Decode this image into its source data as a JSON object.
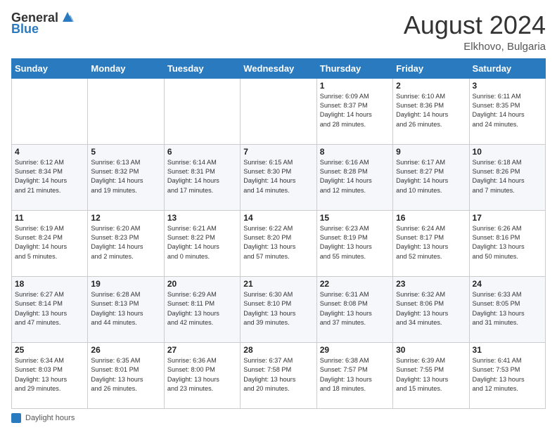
{
  "header": {
    "logo_general": "General",
    "logo_blue": "Blue",
    "month_title": "August 2024",
    "location": "Elkhovo, Bulgaria"
  },
  "days_of_week": [
    "Sunday",
    "Monday",
    "Tuesday",
    "Wednesday",
    "Thursday",
    "Friday",
    "Saturday"
  ],
  "footer": {
    "label": "Daylight hours"
  },
  "weeks": [
    [
      {
        "day": "",
        "detail": ""
      },
      {
        "day": "",
        "detail": ""
      },
      {
        "day": "",
        "detail": ""
      },
      {
        "day": "",
        "detail": ""
      },
      {
        "day": "1",
        "detail": "Sunrise: 6:09 AM\nSunset: 8:37 PM\nDaylight: 14 hours\nand 28 minutes."
      },
      {
        "day": "2",
        "detail": "Sunrise: 6:10 AM\nSunset: 8:36 PM\nDaylight: 14 hours\nand 26 minutes."
      },
      {
        "day": "3",
        "detail": "Sunrise: 6:11 AM\nSunset: 8:35 PM\nDaylight: 14 hours\nand 24 minutes."
      }
    ],
    [
      {
        "day": "4",
        "detail": "Sunrise: 6:12 AM\nSunset: 8:34 PM\nDaylight: 14 hours\nand 21 minutes."
      },
      {
        "day": "5",
        "detail": "Sunrise: 6:13 AM\nSunset: 8:32 PM\nDaylight: 14 hours\nand 19 minutes."
      },
      {
        "day": "6",
        "detail": "Sunrise: 6:14 AM\nSunset: 8:31 PM\nDaylight: 14 hours\nand 17 minutes."
      },
      {
        "day": "7",
        "detail": "Sunrise: 6:15 AM\nSunset: 8:30 PM\nDaylight: 14 hours\nand 14 minutes."
      },
      {
        "day": "8",
        "detail": "Sunrise: 6:16 AM\nSunset: 8:28 PM\nDaylight: 14 hours\nand 12 minutes."
      },
      {
        "day": "9",
        "detail": "Sunrise: 6:17 AM\nSunset: 8:27 PM\nDaylight: 14 hours\nand 10 minutes."
      },
      {
        "day": "10",
        "detail": "Sunrise: 6:18 AM\nSunset: 8:26 PM\nDaylight: 14 hours\nand 7 minutes."
      }
    ],
    [
      {
        "day": "11",
        "detail": "Sunrise: 6:19 AM\nSunset: 8:24 PM\nDaylight: 14 hours\nand 5 minutes."
      },
      {
        "day": "12",
        "detail": "Sunrise: 6:20 AM\nSunset: 8:23 PM\nDaylight: 14 hours\nand 2 minutes."
      },
      {
        "day": "13",
        "detail": "Sunrise: 6:21 AM\nSunset: 8:22 PM\nDaylight: 14 hours\nand 0 minutes."
      },
      {
        "day": "14",
        "detail": "Sunrise: 6:22 AM\nSunset: 8:20 PM\nDaylight: 13 hours\nand 57 minutes."
      },
      {
        "day": "15",
        "detail": "Sunrise: 6:23 AM\nSunset: 8:19 PM\nDaylight: 13 hours\nand 55 minutes."
      },
      {
        "day": "16",
        "detail": "Sunrise: 6:24 AM\nSunset: 8:17 PM\nDaylight: 13 hours\nand 52 minutes."
      },
      {
        "day": "17",
        "detail": "Sunrise: 6:26 AM\nSunset: 8:16 PM\nDaylight: 13 hours\nand 50 minutes."
      }
    ],
    [
      {
        "day": "18",
        "detail": "Sunrise: 6:27 AM\nSunset: 8:14 PM\nDaylight: 13 hours\nand 47 minutes."
      },
      {
        "day": "19",
        "detail": "Sunrise: 6:28 AM\nSunset: 8:13 PM\nDaylight: 13 hours\nand 44 minutes."
      },
      {
        "day": "20",
        "detail": "Sunrise: 6:29 AM\nSunset: 8:11 PM\nDaylight: 13 hours\nand 42 minutes."
      },
      {
        "day": "21",
        "detail": "Sunrise: 6:30 AM\nSunset: 8:10 PM\nDaylight: 13 hours\nand 39 minutes."
      },
      {
        "day": "22",
        "detail": "Sunrise: 6:31 AM\nSunset: 8:08 PM\nDaylight: 13 hours\nand 37 minutes."
      },
      {
        "day": "23",
        "detail": "Sunrise: 6:32 AM\nSunset: 8:06 PM\nDaylight: 13 hours\nand 34 minutes."
      },
      {
        "day": "24",
        "detail": "Sunrise: 6:33 AM\nSunset: 8:05 PM\nDaylight: 13 hours\nand 31 minutes."
      }
    ],
    [
      {
        "day": "25",
        "detail": "Sunrise: 6:34 AM\nSunset: 8:03 PM\nDaylight: 13 hours\nand 29 minutes."
      },
      {
        "day": "26",
        "detail": "Sunrise: 6:35 AM\nSunset: 8:01 PM\nDaylight: 13 hours\nand 26 minutes."
      },
      {
        "day": "27",
        "detail": "Sunrise: 6:36 AM\nSunset: 8:00 PM\nDaylight: 13 hours\nand 23 minutes."
      },
      {
        "day": "28",
        "detail": "Sunrise: 6:37 AM\nSunset: 7:58 PM\nDaylight: 13 hours\nand 20 minutes."
      },
      {
        "day": "29",
        "detail": "Sunrise: 6:38 AM\nSunset: 7:57 PM\nDaylight: 13 hours\nand 18 minutes."
      },
      {
        "day": "30",
        "detail": "Sunrise: 6:39 AM\nSunset: 7:55 PM\nDaylight: 13 hours\nand 15 minutes."
      },
      {
        "day": "31",
        "detail": "Sunrise: 6:41 AM\nSunset: 7:53 PM\nDaylight: 13 hours\nand 12 minutes."
      }
    ]
  ]
}
